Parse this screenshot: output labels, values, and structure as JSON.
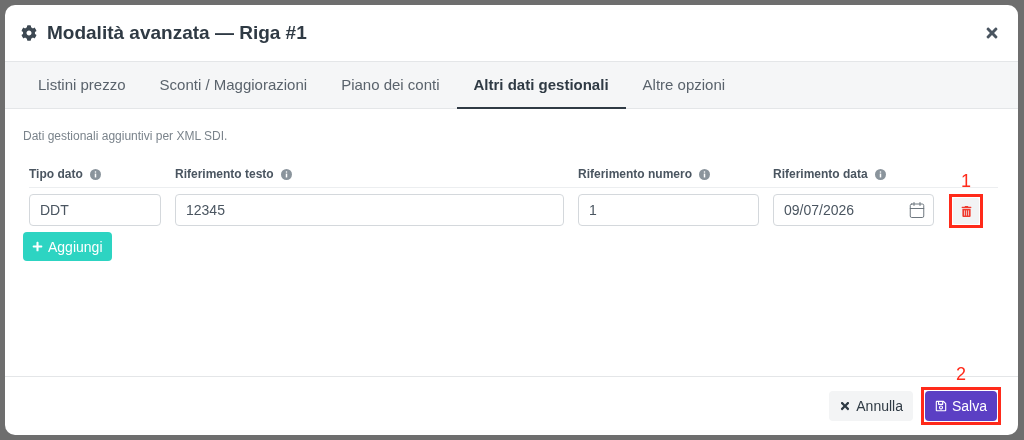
{
  "modal": {
    "title": "Modalità avanzata — Riga #1"
  },
  "tabs": [
    {
      "label": "Listini prezzo",
      "selected": false
    },
    {
      "label": "Sconti / Maggiorazioni",
      "selected": false
    },
    {
      "label": "Piano dei conti",
      "selected": false
    },
    {
      "label": "Altri dati gestionali",
      "selected": true
    },
    {
      "label": "Altre opzioni",
      "selected": false
    }
  ],
  "description": "Dati gestionali aggiuntivi per XML SDI.",
  "table": {
    "columns": [
      {
        "label": "Tipo dato",
        "kind": "text"
      },
      {
        "label": "Riferimento testo",
        "kind": "text"
      },
      {
        "label": "Riferimento numero",
        "kind": "text"
      },
      {
        "label": "Riferimento data",
        "kind": "date"
      }
    ],
    "rows": [
      {
        "values": [
          "DDT",
          "12345",
          "1",
          "09/07/2026"
        ],
        "delete_callout": "1"
      }
    ]
  },
  "add_button": {
    "label": "Aggiungi"
  },
  "footer_buttons": [
    {
      "label": "Annulla",
      "kind": "cancel"
    },
    {
      "label": "Salva",
      "kind": "save",
      "callout": "2"
    }
  ]
}
